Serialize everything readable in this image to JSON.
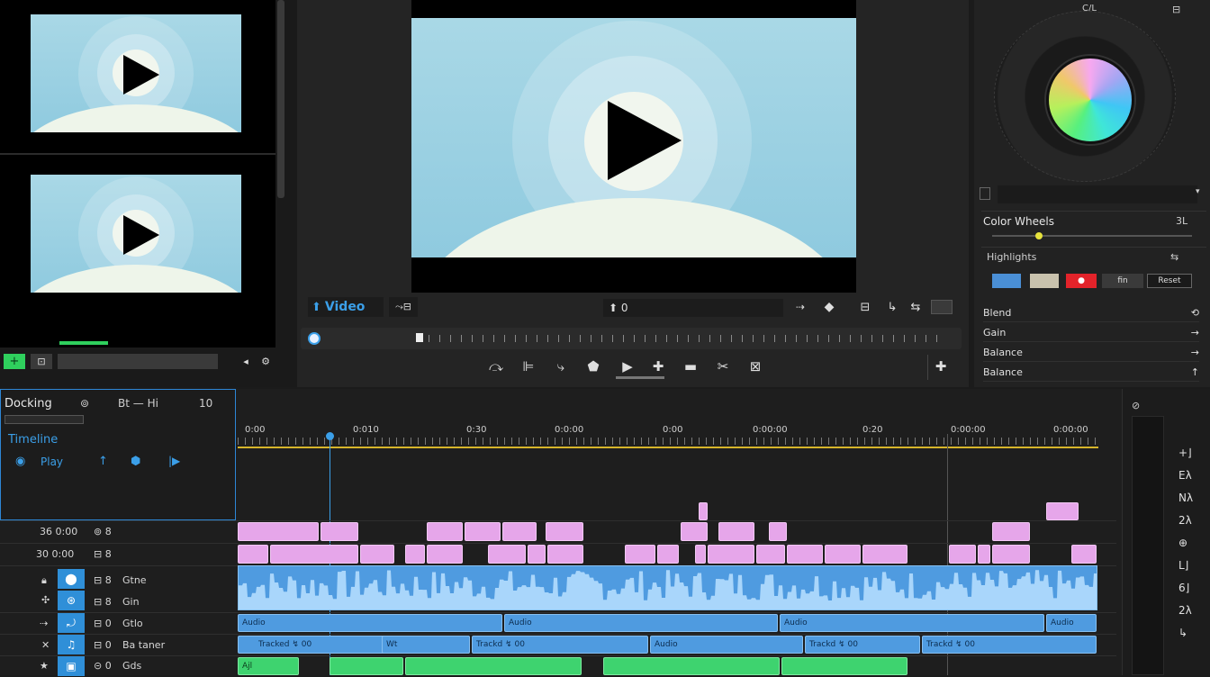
{
  "left_panel": {
    "add_icon": "+",
    "bottom_icons": [
      "⊡",
      "◂",
      "⚙"
    ]
  },
  "viewer": {
    "tab_label": "Video",
    "tab_icon": "arrow-up-icon",
    "toolbar_center": "⬆ 0",
    "toolbar_right": [
      "⇢",
      "◆",
      "⊟",
      "↳",
      "⇆"
    ],
    "transport": [
      "⤼",
      "⊫",
      "⤷",
      "⬟",
      "▶",
      "✚",
      "▬",
      "✂",
      "⊠"
    ],
    "side_icon": "✚"
  },
  "color_panel": {
    "top_label": "C/L",
    "top_right": "⊟",
    "section_title": "Color Wheels",
    "section_value": "3L",
    "sub_title": "Highlights",
    "sub_right": "⇆",
    "swatch_labels": [
      "",
      "",
      "●",
      "fin",
      "Reset"
    ],
    "list": [
      {
        "label": "Blend",
        "icon": "⟲"
      },
      {
        "label": "Gain",
        "icon": "→"
      },
      {
        "label": "Balance",
        "icon": "→"
      },
      {
        "label": "Balance",
        "icon": "↑"
      }
    ]
  },
  "timeline": {
    "header": {
      "title": "Docking",
      "center": "Bt — Hi",
      "right": "10"
    },
    "label_row": "Timeline",
    "tool_icons": [
      "◉",
      "Play",
      "↑",
      "⬢",
      "|▶"
    ],
    "ruler_marks": [
      "0:00",
      "0:010",
      "0:30",
      "0:0:00",
      "0:00",
      "0:00:00",
      "0:20",
      "0:00:00",
      "0:00:00"
    ],
    "tracks": [
      {
        "name": "36 0:00",
        "ctrl": "⊚ 8"
      },
      {
        "name": "30 0:00",
        "ctrl": "⊟ 8"
      },
      {
        "name": "Gtne",
        "ctrl": "⊟ 8"
      },
      {
        "name": "Gin",
        "ctrl": "⊟ 8"
      },
      {
        "name": "Gtlo",
        "ctrl": "⊟ 0"
      },
      {
        "name": "Ba taner",
        "ctrl": "⊟ 0"
      },
      {
        "name": "Gds",
        "ctrl": "⊝ 0"
      }
    ],
    "clip_labels": {
      "blue1": [
        "Audio",
        "Audio",
        "Audio",
        "Audio"
      ],
      "blue2": [
        "Tracked ↯ 00",
        "Wt",
        "Trackd ↯ 00",
        "Audio",
        "Trackd ↯ 00",
        "Trackd ↯ 00"
      ],
      "green": [
        "Ajl"
      ]
    },
    "right_icons": [
      "+⌋",
      "Eλ",
      "Nλ",
      "2λ",
      "⊕",
      "L⌋",
      "6⌋",
      "2λ",
      "↳"
    ]
  }
}
